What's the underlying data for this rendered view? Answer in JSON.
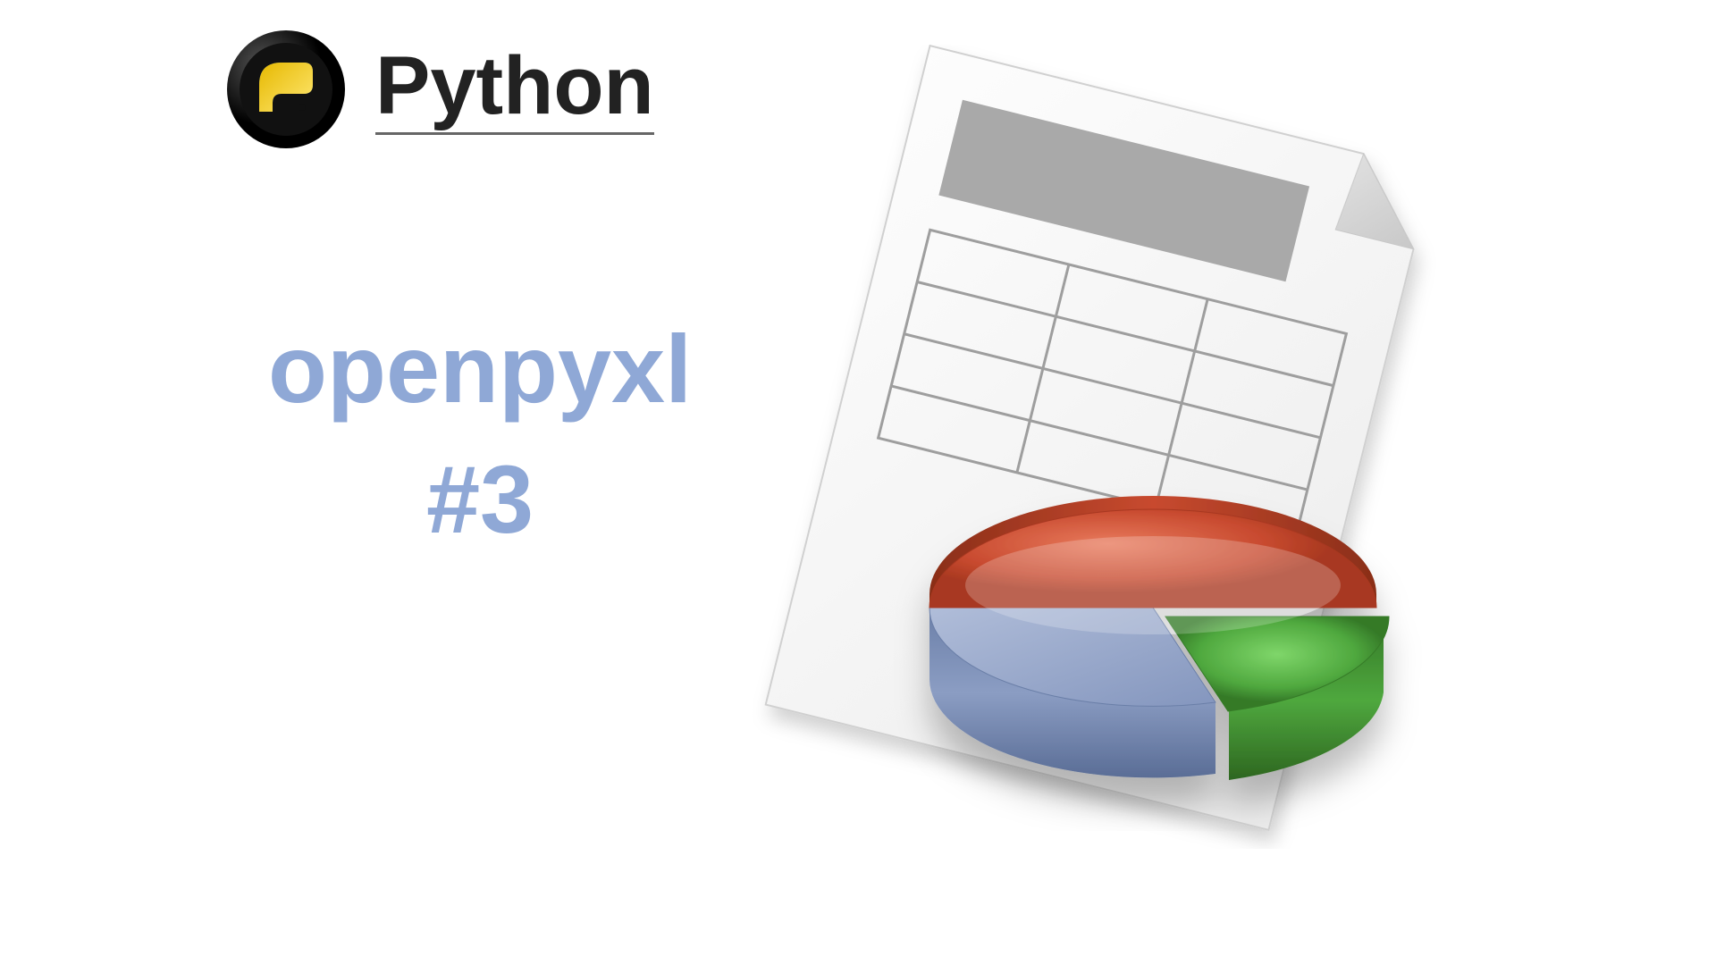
{
  "header": {
    "title": "Python"
  },
  "subtitle": {
    "line1": "openpyxl",
    "line2": "#3"
  },
  "colors": {
    "text_accent": "#8fa8d6",
    "pie_red": "#c84a2f",
    "pie_green": "#4fa83e",
    "pie_blue": "#8b9dc3",
    "sheet_grey": "#e8e8e8",
    "sheet_header": "#a9a9a9",
    "python_blue": "#3776ab",
    "python_yellow": "#ffd43b"
  }
}
